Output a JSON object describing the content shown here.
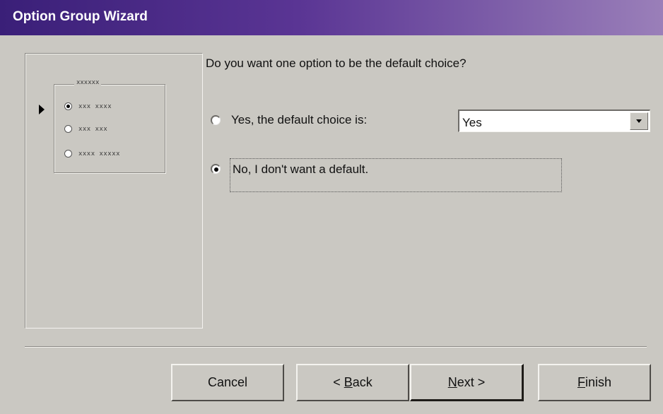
{
  "window": {
    "title": "Option Group Wizard"
  },
  "preview": {
    "group_caption": "xxxxxx",
    "options": [
      {
        "label": "xxx xxxx",
        "selected": true
      },
      {
        "label": "xxx xxx",
        "selected": false
      },
      {
        "label": "xxxx xxxxx",
        "selected": false
      }
    ],
    "pointer_icon": "triangle-right-icon"
  },
  "question": "Do you want one option to be the default choice?",
  "options": {
    "yes_label": "Yes, the default choice is:",
    "yes_checked": false,
    "no_label": "No, I don't want a default.",
    "no_checked": true
  },
  "default_choice": {
    "value": "Yes",
    "icon": "chevron-down-icon"
  },
  "buttons": {
    "cancel": "Cancel",
    "back_prefix": "< ",
    "back_key": "B",
    "back_rest": "ack",
    "next_key": "N",
    "next_rest": "ext >",
    "finish_key": "F",
    "finish_rest": "inish"
  }
}
